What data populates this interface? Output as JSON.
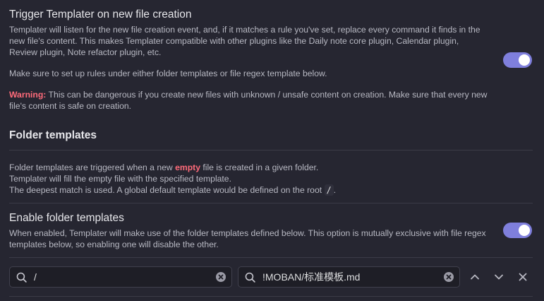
{
  "trigger": {
    "title": "Trigger Templater on new file creation",
    "para1": "Templater will listen for the new file creation event, and, if it matches a rule you've set, replace every command it finds in the new file's content. This makes Templater compatible with other plugins like the Daily note core plugin, Calendar plugin, Review plugin, Note refactor plugin, etc.",
    "para2": "Make sure to set up rules under either folder templates or file regex template below.",
    "warning_label": "Warning:",
    "warning_text": " This can be dangerous if you create new files with unknown / unsafe content on creation. Make sure that every new file's content is safe on creation.",
    "toggle_on": true
  },
  "folder_templates": {
    "heading": "Folder templates",
    "line1_pre": "Folder templates are triggered when a new ",
    "line1_em": "empty",
    "line1_post": " file is created in a given folder.",
    "line2": "Templater will fill the empty file with the specified template.",
    "line3": "The deepest match is used. A global default template would be defined on the root ",
    "line3_code": "/",
    "line3_end": "."
  },
  "enable_folder": {
    "title": "Enable folder templates",
    "desc": "When enabled, Templater will make use of the folder templates defined below. This option is mutually exclusive with file regex templates below, so enabling one will disable the other.",
    "toggle_on": true
  },
  "folder_row": {
    "folder_value": "/",
    "template_value": "!MOBAN/标准模板.md"
  },
  "icons": {
    "search": "search-icon",
    "clear": "clear-icon",
    "up": "chevron-up-icon",
    "down": "chevron-down-icon",
    "close": "close-icon"
  },
  "colors": {
    "accent": "#7f7fdc",
    "warning": "#ff6b7a",
    "background": "#262631"
  }
}
